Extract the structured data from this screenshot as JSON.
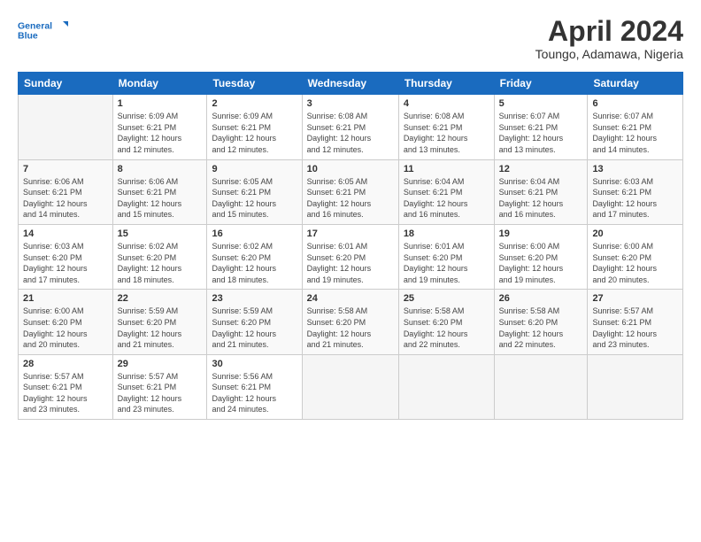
{
  "header": {
    "logo_line1": "General",
    "logo_line2": "Blue",
    "month": "April 2024",
    "location": "Toungo, Adamawa, Nigeria"
  },
  "days_of_week": [
    "Sunday",
    "Monday",
    "Tuesday",
    "Wednesday",
    "Thursday",
    "Friday",
    "Saturday"
  ],
  "weeks": [
    [
      {
        "num": "",
        "info": ""
      },
      {
        "num": "1",
        "info": "Sunrise: 6:09 AM\nSunset: 6:21 PM\nDaylight: 12 hours\nand 12 minutes."
      },
      {
        "num": "2",
        "info": "Sunrise: 6:09 AM\nSunset: 6:21 PM\nDaylight: 12 hours\nand 12 minutes."
      },
      {
        "num": "3",
        "info": "Sunrise: 6:08 AM\nSunset: 6:21 PM\nDaylight: 12 hours\nand 12 minutes."
      },
      {
        "num": "4",
        "info": "Sunrise: 6:08 AM\nSunset: 6:21 PM\nDaylight: 12 hours\nand 13 minutes."
      },
      {
        "num": "5",
        "info": "Sunrise: 6:07 AM\nSunset: 6:21 PM\nDaylight: 12 hours\nand 13 minutes."
      },
      {
        "num": "6",
        "info": "Sunrise: 6:07 AM\nSunset: 6:21 PM\nDaylight: 12 hours\nand 14 minutes."
      }
    ],
    [
      {
        "num": "7",
        "info": "Sunrise: 6:06 AM\nSunset: 6:21 PM\nDaylight: 12 hours\nand 14 minutes."
      },
      {
        "num": "8",
        "info": "Sunrise: 6:06 AM\nSunset: 6:21 PM\nDaylight: 12 hours\nand 15 minutes."
      },
      {
        "num": "9",
        "info": "Sunrise: 6:05 AM\nSunset: 6:21 PM\nDaylight: 12 hours\nand 15 minutes."
      },
      {
        "num": "10",
        "info": "Sunrise: 6:05 AM\nSunset: 6:21 PM\nDaylight: 12 hours\nand 16 minutes."
      },
      {
        "num": "11",
        "info": "Sunrise: 6:04 AM\nSunset: 6:21 PM\nDaylight: 12 hours\nand 16 minutes."
      },
      {
        "num": "12",
        "info": "Sunrise: 6:04 AM\nSunset: 6:21 PM\nDaylight: 12 hours\nand 16 minutes."
      },
      {
        "num": "13",
        "info": "Sunrise: 6:03 AM\nSunset: 6:21 PM\nDaylight: 12 hours\nand 17 minutes."
      }
    ],
    [
      {
        "num": "14",
        "info": "Sunrise: 6:03 AM\nSunset: 6:20 PM\nDaylight: 12 hours\nand 17 minutes."
      },
      {
        "num": "15",
        "info": "Sunrise: 6:02 AM\nSunset: 6:20 PM\nDaylight: 12 hours\nand 18 minutes."
      },
      {
        "num": "16",
        "info": "Sunrise: 6:02 AM\nSunset: 6:20 PM\nDaylight: 12 hours\nand 18 minutes."
      },
      {
        "num": "17",
        "info": "Sunrise: 6:01 AM\nSunset: 6:20 PM\nDaylight: 12 hours\nand 19 minutes."
      },
      {
        "num": "18",
        "info": "Sunrise: 6:01 AM\nSunset: 6:20 PM\nDaylight: 12 hours\nand 19 minutes."
      },
      {
        "num": "19",
        "info": "Sunrise: 6:00 AM\nSunset: 6:20 PM\nDaylight: 12 hours\nand 19 minutes."
      },
      {
        "num": "20",
        "info": "Sunrise: 6:00 AM\nSunset: 6:20 PM\nDaylight: 12 hours\nand 20 minutes."
      }
    ],
    [
      {
        "num": "21",
        "info": "Sunrise: 6:00 AM\nSunset: 6:20 PM\nDaylight: 12 hours\nand 20 minutes."
      },
      {
        "num": "22",
        "info": "Sunrise: 5:59 AM\nSunset: 6:20 PM\nDaylight: 12 hours\nand 21 minutes."
      },
      {
        "num": "23",
        "info": "Sunrise: 5:59 AM\nSunset: 6:20 PM\nDaylight: 12 hours\nand 21 minutes."
      },
      {
        "num": "24",
        "info": "Sunrise: 5:58 AM\nSunset: 6:20 PM\nDaylight: 12 hours\nand 21 minutes."
      },
      {
        "num": "25",
        "info": "Sunrise: 5:58 AM\nSunset: 6:20 PM\nDaylight: 12 hours\nand 22 minutes."
      },
      {
        "num": "26",
        "info": "Sunrise: 5:58 AM\nSunset: 6:20 PM\nDaylight: 12 hours\nand 22 minutes."
      },
      {
        "num": "27",
        "info": "Sunrise: 5:57 AM\nSunset: 6:21 PM\nDaylight: 12 hours\nand 23 minutes."
      }
    ],
    [
      {
        "num": "28",
        "info": "Sunrise: 5:57 AM\nSunset: 6:21 PM\nDaylight: 12 hours\nand 23 minutes."
      },
      {
        "num": "29",
        "info": "Sunrise: 5:57 AM\nSunset: 6:21 PM\nDaylight: 12 hours\nand 23 minutes."
      },
      {
        "num": "30",
        "info": "Sunrise: 5:56 AM\nSunset: 6:21 PM\nDaylight: 12 hours\nand 24 minutes."
      },
      {
        "num": "",
        "info": ""
      },
      {
        "num": "",
        "info": ""
      },
      {
        "num": "",
        "info": ""
      },
      {
        "num": "",
        "info": ""
      }
    ]
  ]
}
